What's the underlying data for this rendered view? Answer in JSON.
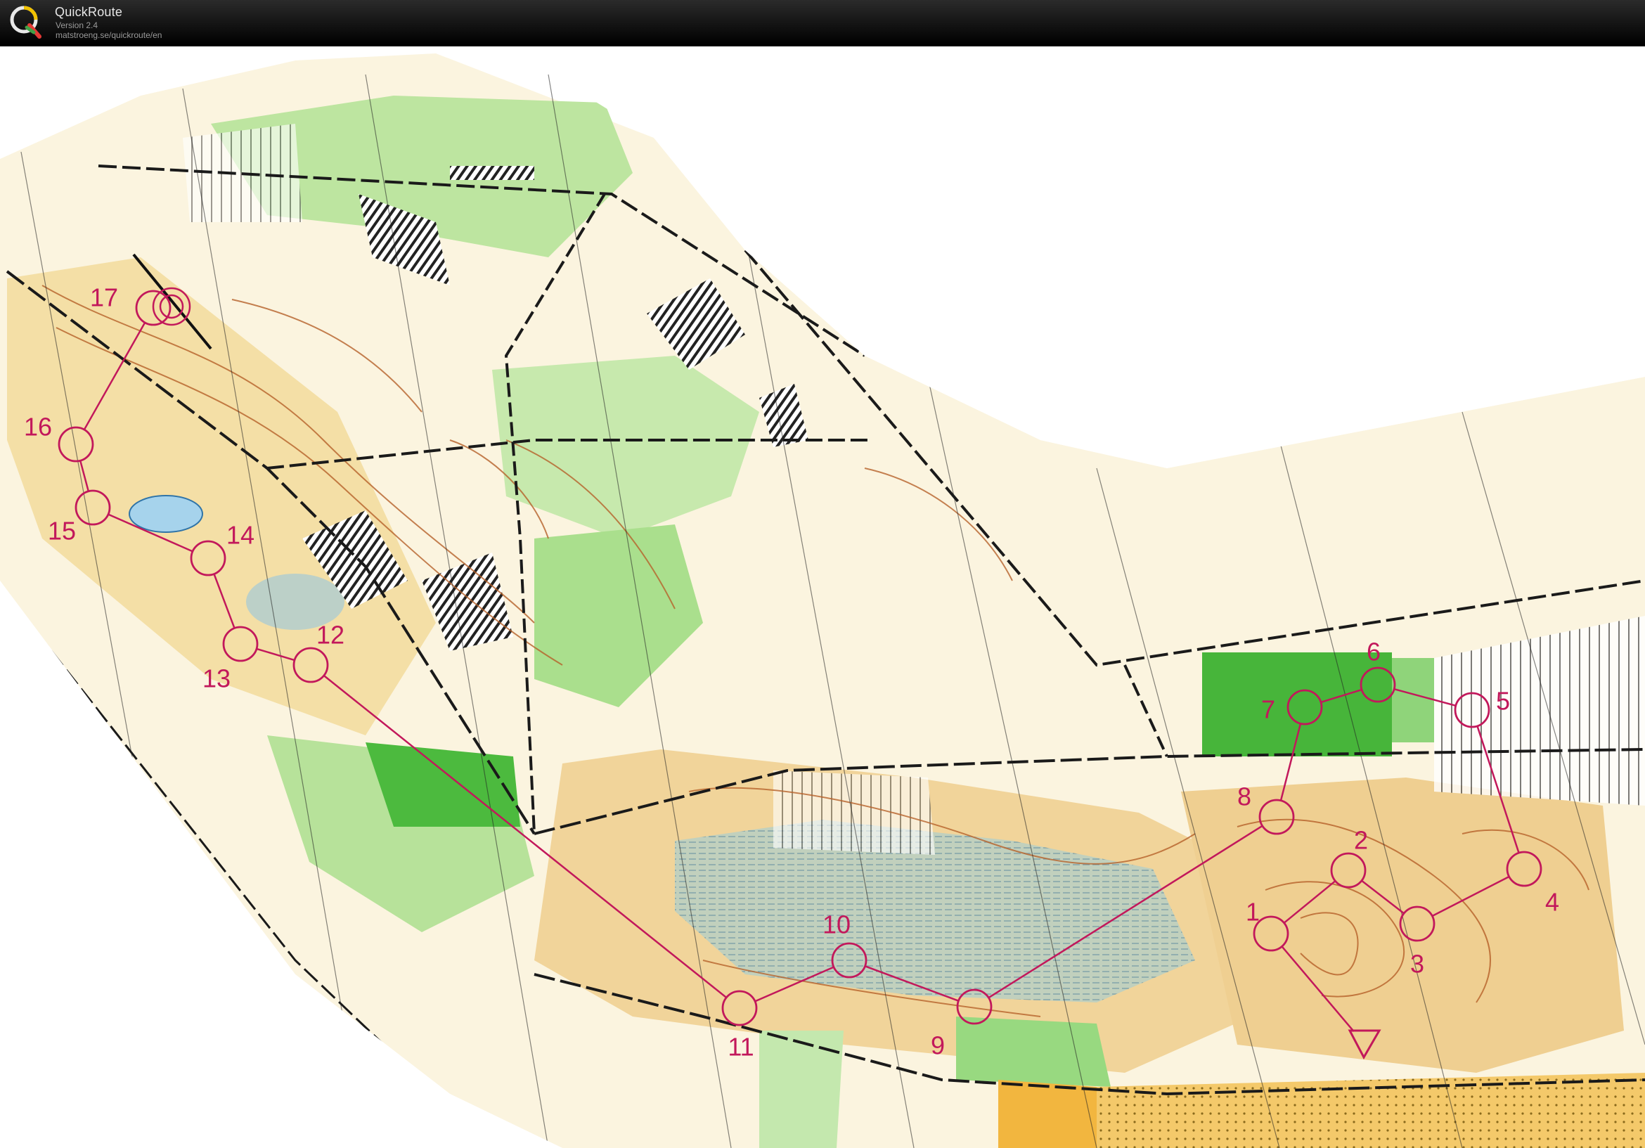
{
  "app": {
    "name": "QuickRoute",
    "version": "Version 2.4",
    "url": "matstroeng.se/quickroute/en",
    "logo_icon": "quickroute-q-logo-icon"
  },
  "map": {
    "course_color": "#c2185b",
    "controls": [
      {
        "number": "1"
      },
      {
        "number": "2"
      },
      {
        "number": "3"
      },
      {
        "number": "4"
      },
      {
        "number": "5"
      },
      {
        "number": "6"
      },
      {
        "number": "7"
      },
      {
        "number": "8"
      },
      {
        "number": "9"
      },
      {
        "number": "10"
      },
      {
        "number": "11"
      },
      {
        "number": "12"
      },
      {
        "number": "13"
      },
      {
        "number": "14"
      },
      {
        "number": "15"
      },
      {
        "number": "16"
      },
      {
        "number": "17"
      }
    ]
  }
}
